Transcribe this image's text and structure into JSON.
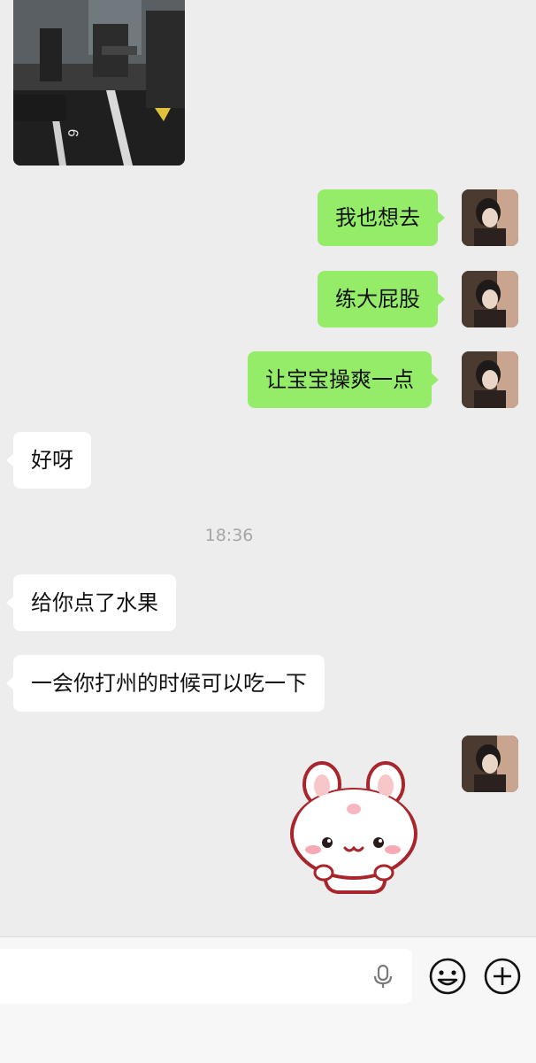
{
  "messages": {
    "m1": "我也想去",
    "m2": "练大屁股",
    "m3": "让宝宝操爽一点",
    "m4": "好呀",
    "m5": "给你点了水果",
    "m6": "一会你打州的时候可以吃一下"
  },
  "timestamp": "18:36",
  "colors": {
    "self_bubble": "#95ec69",
    "other_bubble": "#ffffff",
    "background": "#ededed"
  },
  "input_bar": {
    "icons": [
      "microphone-icon",
      "emoji-icon",
      "plus-icon"
    ]
  }
}
